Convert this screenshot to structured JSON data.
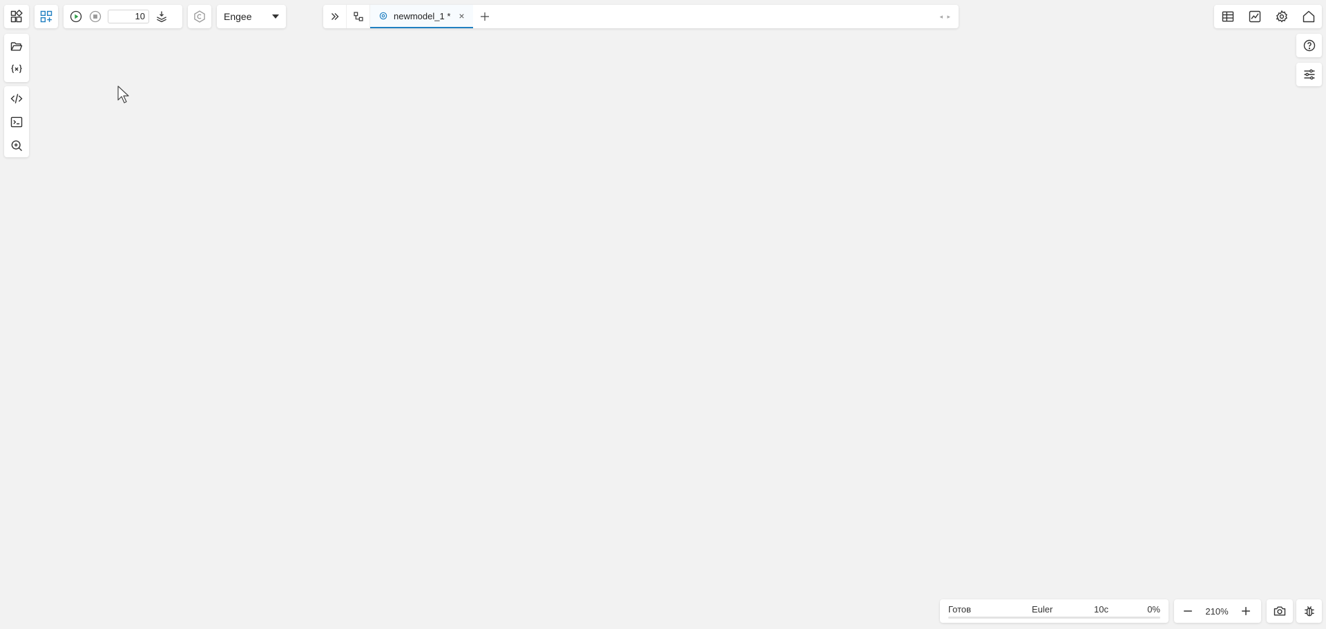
{
  "toolbar": {
    "sim_time": "10",
    "engine": "Engee"
  },
  "tabs": [
    {
      "label": "newmodel_1 *",
      "close": "×"
    }
  ],
  "status": {
    "state": "Готов",
    "solver": "Euler",
    "time": "10с",
    "progress_label": "0%",
    "progress": 0
  },
  "zoom": {
    "value": "210%"
  },
  "colors": {
    "accent": "#1f7fc1",
    "run_green": "#2e9e47",
    "background": "#f2f2f2"
  },
  "icons": {
    "logo": "engee-blocks-icon",
    "blocks": "block-library-icon",
    "run": "play-icon",
    "stop": "stop-icon",
    "deploy": "layers-download-icon",
    "codegen": "c-hexagon-icon",
    "expand": "double-chevron-right-icon",
    "model_tree": "model-tree-icon",
    "tab_model": "model-icon",
    "add_tab": "plus-icon",
    "folder": "folder-open-icon",
    "variables": "variables-icon",
    "code": "code-icon",
    "terminal": "terminal-icon",
    "search": "zoom-search-icon",
    "table": "table-icon",
    "graph": "graph-icon",
    "gear": "gear-icon",
    "home": "home-icon",
    "help": "help-icon",
    "sliders": "sliders-icon",
    "zoom_out": "minus-icon",
    "zoom_in": "plus-icon",
    "camera": "camera-icon",
    "bug": "bug-icon"
  }
}
